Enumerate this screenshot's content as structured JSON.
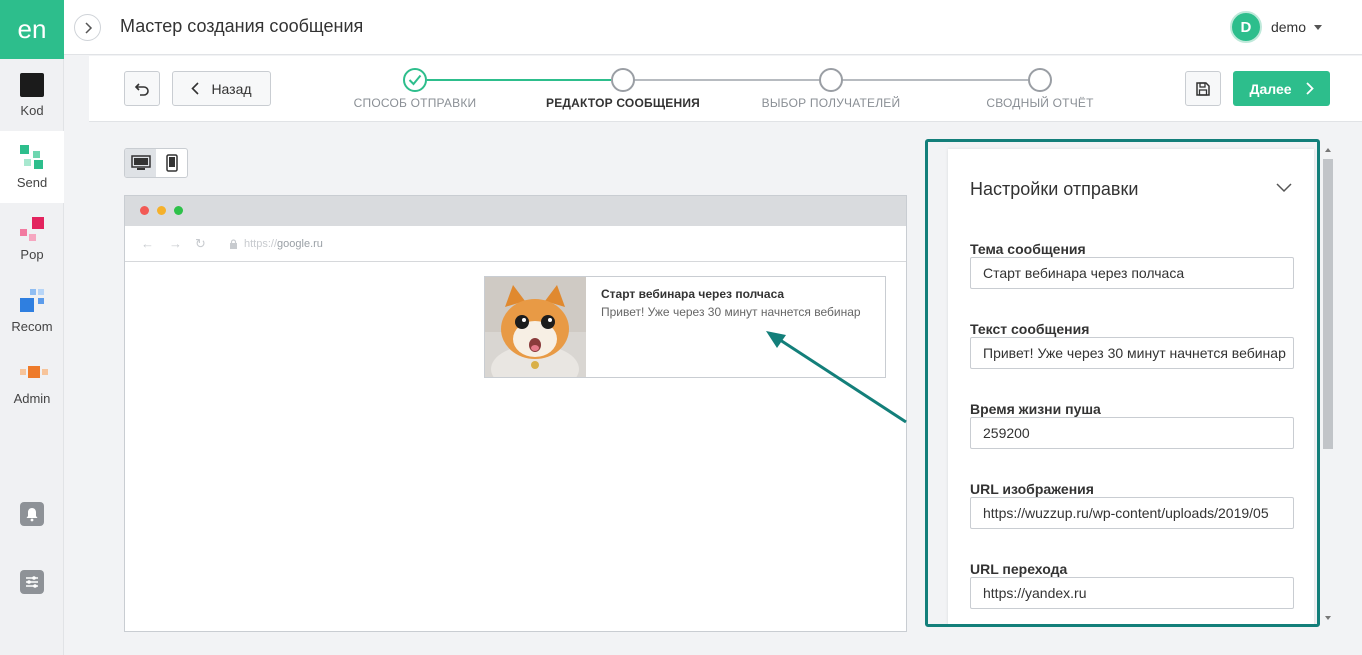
{
  "app": {
    "logo_text": "en"
  },
  "sidebar": {
    "items": [
      {
        "label": "Kod",
        "icon": "kod-icon"
      },
      {
        "label": "Send",
        "icon": "send-icon",
        "active": true
      },
      {
        "label": "Pop",
        "icon": "pop-icon"
      },
      {
        "label": "Recom",
        "icon": "recom-icon"
      },
      {
        "label": "Admin",
        "icon": "admin-icon"
      }
    ],
    "utility_icons": [
      "bell-icon",
      "sliders-icon"
    ]
  },
  "header": {
    "title": "Мастер создания сообщения",
    "user_initial": "D",
    "user_name": "demo"
  },
  "toolbar": {
    "back_label": "Назад",
    "next_label": "Далее"
  },
  "steps": [
    {
      "label": "СПОСОБ ОТПРАВКИ",
      "state": "done"
    },
    {
      "label": "РЕДАКТОР СООБЩЕНИЯ",
      "state": "active"
    },
    {
      "label": "ВЫБОР ПОЛУЧАТЕЛЕЙ",
      "state": "pending"
    },
    {
      "label": "СВОДНЫЙ ОТЧЁТ",
      "state": "pending"
    }
  ],
  "preview": {
    "url_protocol": "https://",
    "url_host": "google.ru",
    "push_title": "Старт вебинара через полчаса",
    "push_body": "Привет! Уже через 30 минут начнется вебинар"
  },
  "settings": {
    "title": "Настройки отправки",
    "fields": [
      {
        "label": "Тема сообщения",
        "value": "Старт вебинара через полчаса"
      },
      {
        "label": "Текст сообщения",
        "value": "Привет! Уже через 30 минут начнется вебинар"
      },
      {
        "label": "Время жизни пуша",
        "value": "259200"
      },
      {
        "label": "URL изображения",
        "value": "https://wuzzup.ru/wp-content/uploads/2019/05"
      },
      {
        "label": "URL перехода",
        "value": "https://yandex.ru"
      }
    ]
  },
  "colors": {
    "accent": "#2dbe8c",
    "highlight_border": "#137f7a"
  }
}
